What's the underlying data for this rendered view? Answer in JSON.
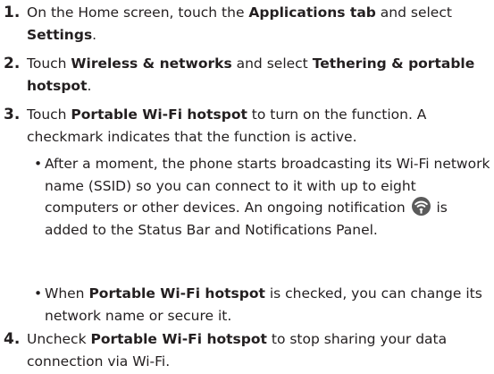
{
  "steps": [
    {
      "number": "1.",
      "parts": [
        "On the Home screen, touch the ",
        "Applications tab",
        " and select ",
        "Settings",
        "."
      ]
    },
    {
      "number": "2.",
      "parts": [
        "Touch ",
        "Wireless & networks",
        " and select ",
        "Tethering & portable hotspot",
        "."
      ]
    },
    {
      "number": "3.",
      "parts": [
        "Touch ",
        "Portable Wi-Fi hotspot",
        " to turn on the function. A checkmark indicates that the function is active."
      ]
    },
    {
      "number": "4.",
      "parts": [
        "Uncheck ",
        "Portable Wi-Fi hotspot",
        " to stop sharing your data connection via Wi-Fi."
      ]
    }
  ],
  "bullets": [
    {
      "marker": "•",
      "parts": [
        "After a moment, the phone starts broadcasting its Wi-Fi network name (SSID) so you can connect to it with up to eight computers or other devices. An ongoing notification ",
        " is added to the Status Bar and Notifications Panel."
      ],
      "icon": "wifi-hotspot-notification-icon"
    },
    {
      "marker": "•",
      "parts": [
        "When ",
        "Portable Wi-Fi hotspot",
        " is checked, you can change its network name or secure it."
      ]
    }
  ],
  "colors": {
    "text": "#231f20",
    "icon_bg": "#5a5a5a",
    "icon_fg": "#ffffff"
  }
}
